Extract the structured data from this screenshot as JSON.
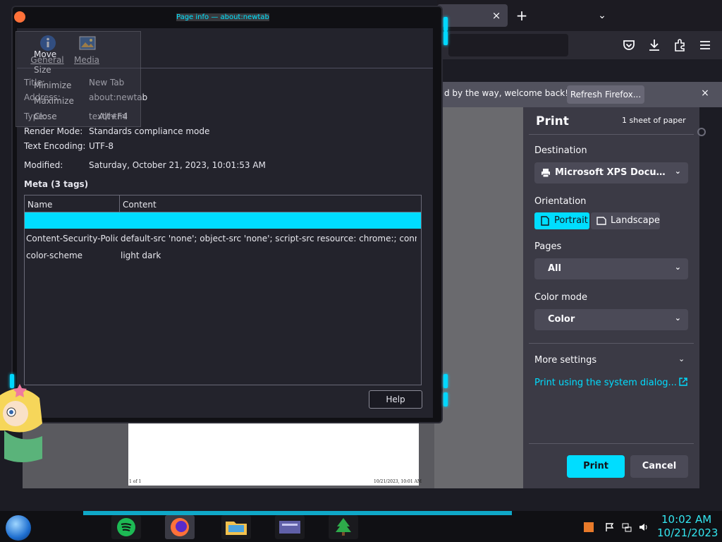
{
  "firefox": {
    "tab_close": "×",
    "new_tab": "+",
    "tab_list": "⌄",
    "notification_text": "d by the way, welcome back!",
    "refresh_button": "Refresh Firefox...",
    "notification_close": "×"
  },
  "print": {
    "title": "Print",
    "sheets": "1 sheet of paper",
    "destination_label": "Destination",
    "destination_value": "Microsoft XPS Docume...",
    "orientation_label": "Orientation",
    "portrait": "Portrait",
    "landscape": "Landscape",
    "pages_label": "Pages",
    "pages_value": "All",
    "color_mode_label": "Color mode",
    "color_mode_value": "Color",
    "more_settings": "More settings",
    "system_dialog": "Print using the system dialog...",
    "print_button": "Print",
    "cancel_button": "Cancel",
    "chevron": "⌄",
    "preview_footer_left": "1 of 1",
    "preview_footer_right": "10/21/2023, 10:01 AM",
    "accent_color": "#00ddff"
  },
  "page_info": {
    "window_title": "Page info — about:newtab",
    "tabs": [
      {
        "label": "General",
        "icon": "info-icon"
      },
      {
        "label": "Media",
        "icon": "media-icon"
      }
    ],
    "fields": {
      "title_label": "Title:",
      "title_value": "New Tab",
      "address_label": "Address:",
      "address_value": "about:newtab",
      "type_label": "Type:",
      "type_value": "text/html",
      "render_label": "Render Mode:",
      "render_value": "Standards compliance mode",
      "encoding_label": "Text Encoding:",
      "encoding_value": "UTF-8",
      "modified_label": "Modified:",
      "modified_value": "Saturday, October 21, 2023, 10:01:53 AM"
    },
    "meta_title": "Meta (3 tags)",
    "meta_columns": [
      "Name",
      "Content"
    ],
    "meta_rows": [
      {
        "name": "",
        "content": ""
      },
      {
        "name": "Content-Security-Polic...",
        "content": "default-src 'none'; object-src 'none'; script-src resource: chrome:; connect-src ..."
      },
      {
        "name": "color-scheme",
        "content": "light dark"
      }
    ],
    "help_button": "Help"
  },
  "window_menu": {
    "items": [
      "Move",
      "Size",
      "Minimize",
      "Maximize",
      "Close"
    ],
    "close_accel": "Alt+F4"
  },
  "taskbar": {
    "time": "10:02 AM",
    "date": "10/21/2023",
    "clock_color": "#33e6f0"
  }
}
